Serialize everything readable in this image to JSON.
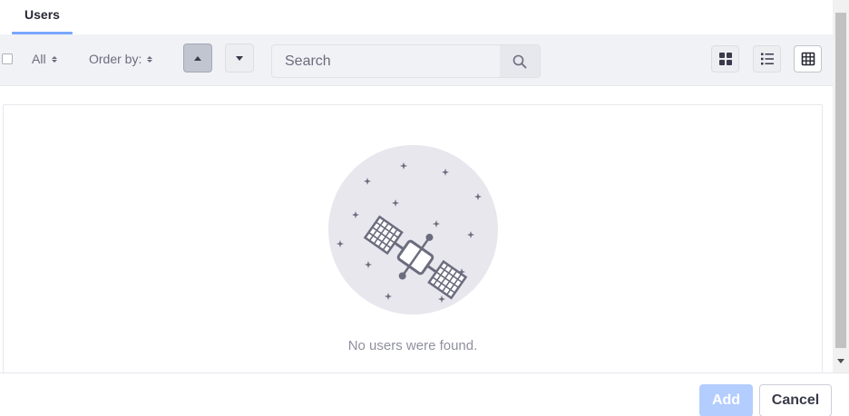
{
  "tabs": [
    {
      "label": "Users",
      "active": true
    }
  ],
  "toolbar": {
    "filter_label": "All",
    "order_label": "Order by:",
    "sort_asc_icon": "caret-up-icon",
    "sort_desc_icon": "caret-down-icon",
    "search": {
      "placeholder": "Search",
      "value": "",
      "icon": "search-icon"
    },
    "view_modes": [
      {
        "name": "cards",
        "icon": "cards-icon",
        "active": false
      },
      {
        "name": "list",
        "icon": "list-icon",
        "active": false
      },
      {
        "name": "table",
        "icon": "table-icon",
        "active": true
      }
    ]
  },
  "empty_state": {
    "illustration": "satellite-icon",
    "message": "No users were found."
  },
  "footer": {
    "add_label": "Add",
    "cancel_label": "Cancel"
  },
  "colors": {
    "accent": "#0b5fff",
    "add_button_disabled": "#b3cdff",
    "toolbar_bg": "#f1f2f5",
    "empty_text": "#8f909e"
  }
}
